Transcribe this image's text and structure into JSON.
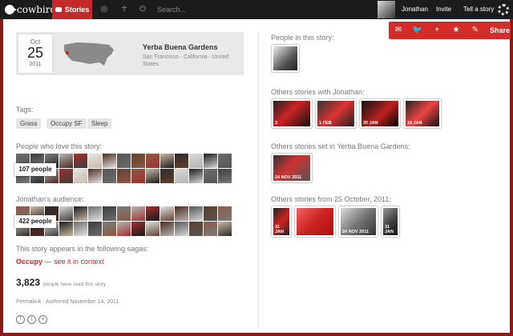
{
  "nav": {
    "logo": "cowbird",
    "stories_tab": "Stories",
    "search_placeholder": "Search...",
    "user_name": "Jonathan",
    "invite": "Invite",
    "tell_story": "Tell a story"
  },
  "story": {
    "date": {
      "month": "Oct",
      "day": "25",
      "year": "2011"
    },
    "place_name": "Yerba Buena Gardens",
    "place_address": "San Francisco · California · United States"
  },
  "tags": {
    "label": "Tags:",
    "items": [
      "Grass",
      "Occupy SF",
      "Sleep"
    ]
  },
  "lovers": {
    "label": "People who love this story:",
    "count_label": "107 people"
  },
  "audience": {
    "label": "Jonathan's audience:",
    "count_label": "422 people"
  },
  "sagas": {
    "label": "This story appears in the following sagas:",
    "name": "Occupy",
    "link": "— see it in context"
  },
  "reads": {
    "count": "3,823",
    "text": "people have read this story"
  },
  "meta": {
    "permalink": "Permalink",
    "separator": "·",
    "authored": "Authored November 14, 2011"
  },
  "share_circles": [
    "f",
    "t",
    "e"
  ],
  "share_bar": {
    "icons": [
      "mail-icon",
      "twitter-icon",
      "plus-icon",
      "star-icon",
      "pencil-icon"
    ],
    "glyphs": [
      "✉",
      "🐦",
      "+",
      "★",
      "✎"
    ],
    "label": "Share"
  },
  "right": {
    "people_label": "People in this story:",
    "others_person_label": "Others stories with Jonathan:",
    "others_person_captions": [
      "3",
      "1 FEB",
      "30 JAN",
      "19 JAN"
    ],
    "others_place_label": "Others stories set in Yerba Buena Gardens:",
    "others_place_captions": [
      "24 NOV 2011"
    ],
    "others_date_label": "Others stories from 25 October, 2011:",
    "others_date_captions": [
      "31 JAN",
      "",
      "24 NOV 2011",
      "31 JAN"
    ]
  },
  "colors": {
    "accent": "#c42a2a",
    "frame": "#8a1a1a",
    "topbar": "#1c1c1c",
    "sharebar": "#d42b2b"
  }
}
